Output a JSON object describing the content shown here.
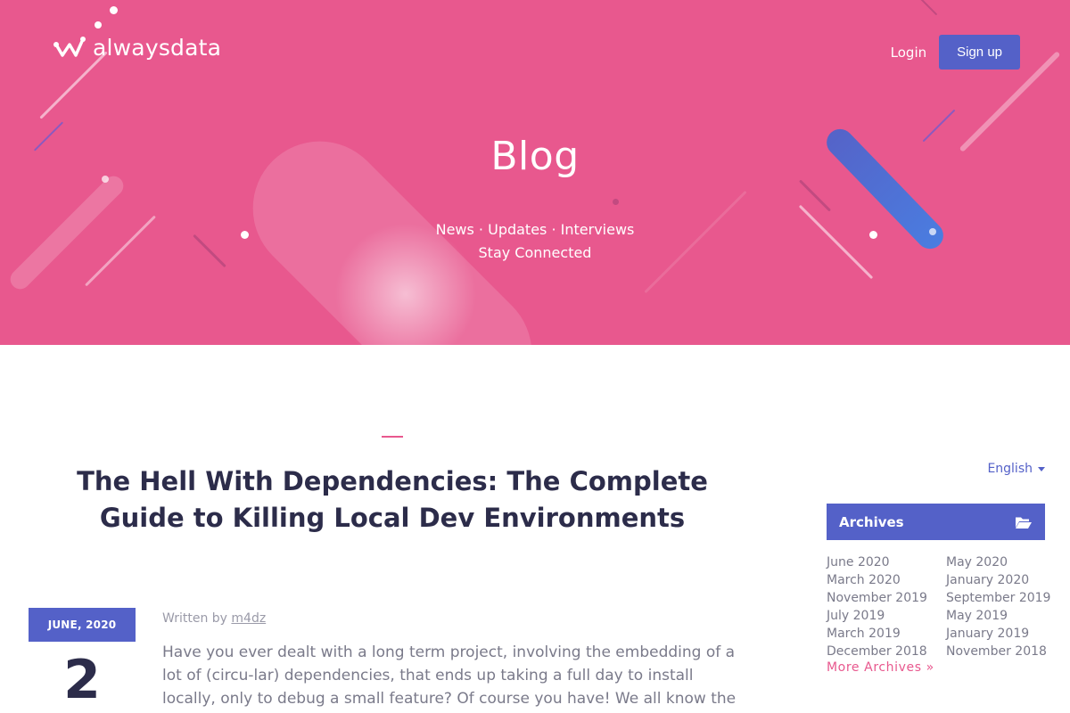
{
  "header": {
    "logo_text": "alwaysdata",
    "login_label": "Login",
    "signup_label": "Sign up",
    "title": "Blog",
    "subtitle_line1": "News · Updates · Interviews",
    "subtitle_line2": "Stay Connected"
  },
  "colors": {
    "hero_bg": "#e8588e",
    "accent_blue": "#5461c8",
    "text_dark": "#2c2c4a",
    "link_pink": "#e8588e"
  },
  "post": {
    "title": "The Hell With Dependencies: The Complete Guide to Killing Local Dev Environments",
    "date_month": "JUNE, 2020",
    "date_day": "2",
    "written_by": "Written by",
    "author": "m4dz",
    "excerpt": "Have you ever dealt with a long term project, involving the embedding of a lot of (circu-lar) dependencies, that ends up taking a full day to install locally, only to debug a small feature? Of course you have! We all know the awkward situation when you delay starting"
  },
  "sidebar": {
    "language": "English",
    "archives_title": "Archives",
    "archives_icon": "folder-open-icon",
    "archive_links": [
      "June 2020",
      "May 2020",
      "March 2020",
      "January 2020",
      "November 2019",
      "September 2019",
      "July 2019",
      "May 2019",
      "March 2019",
      "January 2019",
      "December 2018",
      "November 2018"
    ],
    "more_archives": "More Archives »"
  }
}
